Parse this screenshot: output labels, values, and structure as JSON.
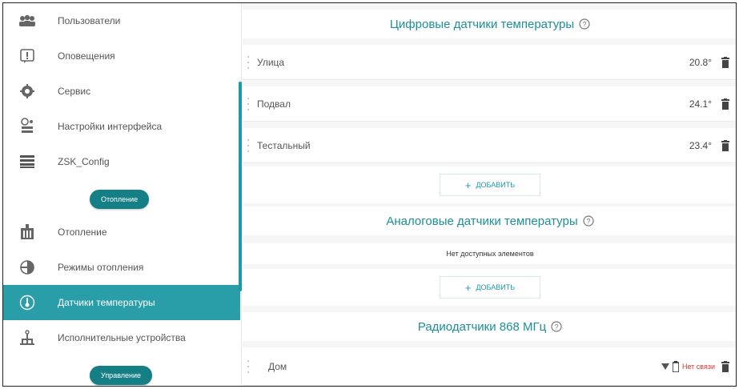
{
  "sidebar": {
    "items": [
      {
        "label": "Пользователи",
        "icon": "users-icon"
      },
      {
        "label": "Оповещения",
        "icon": "notifications-icon"
      },
      {
        "label": "Сервис",
        "icon": "service-icon"
      },
      {
        "label": "Настройки интерфейса",
        "icon": "interface-settings-icon"
      },
      {
        "label": "ZSK_Config",
        "icon": "list-icon"
      },
      {
        "label": "Отопление",
        "icon": "heating-icon"
      },
      {
        "label": "Режимы отопления",
        "icon": "heating-modes-icon"
      },
      {
        "label": "Датчики температуры",
        "icon": "thermometer-icon"
      },
      {
        "label": "Исполнительные устройства",
        "icon": "actuators-icon"
      }
    ],
    "section_heating": "Отопление",
    "section_control": "Управление"
  },
  "digital": {
    "title": "Цифровые датчики температуры",
    "rows": [
      {
        "label": "Улица",
        "value": "20.8°"
      },
      {
        "label": "Подвал",
        "value": "24.1°"
      },
      {
        "label": "Тестальный",
        "value": "23.4°"
      }
    ],
    "add_label": "ДОБАВИТЬ"
  },
  "analog": {
    "title": "Аналоговые датчики температуры",
    "empty": "Нет доступных элементов",
    "add_label": "ДОБАВИТЬ"
  },
  "radio": {
    "title": "Радиодатчики 868 МГц",
    "rows": [
      {
        "label": "Дом",
        "status": "Нет связи"
      }
    ]
  },
  "colors": {
    "accent": "#2a9ea8",
    "pill": "#157f86",
    "title": "#1a8f9a",
    "error": "#dd3333"
  }
}
